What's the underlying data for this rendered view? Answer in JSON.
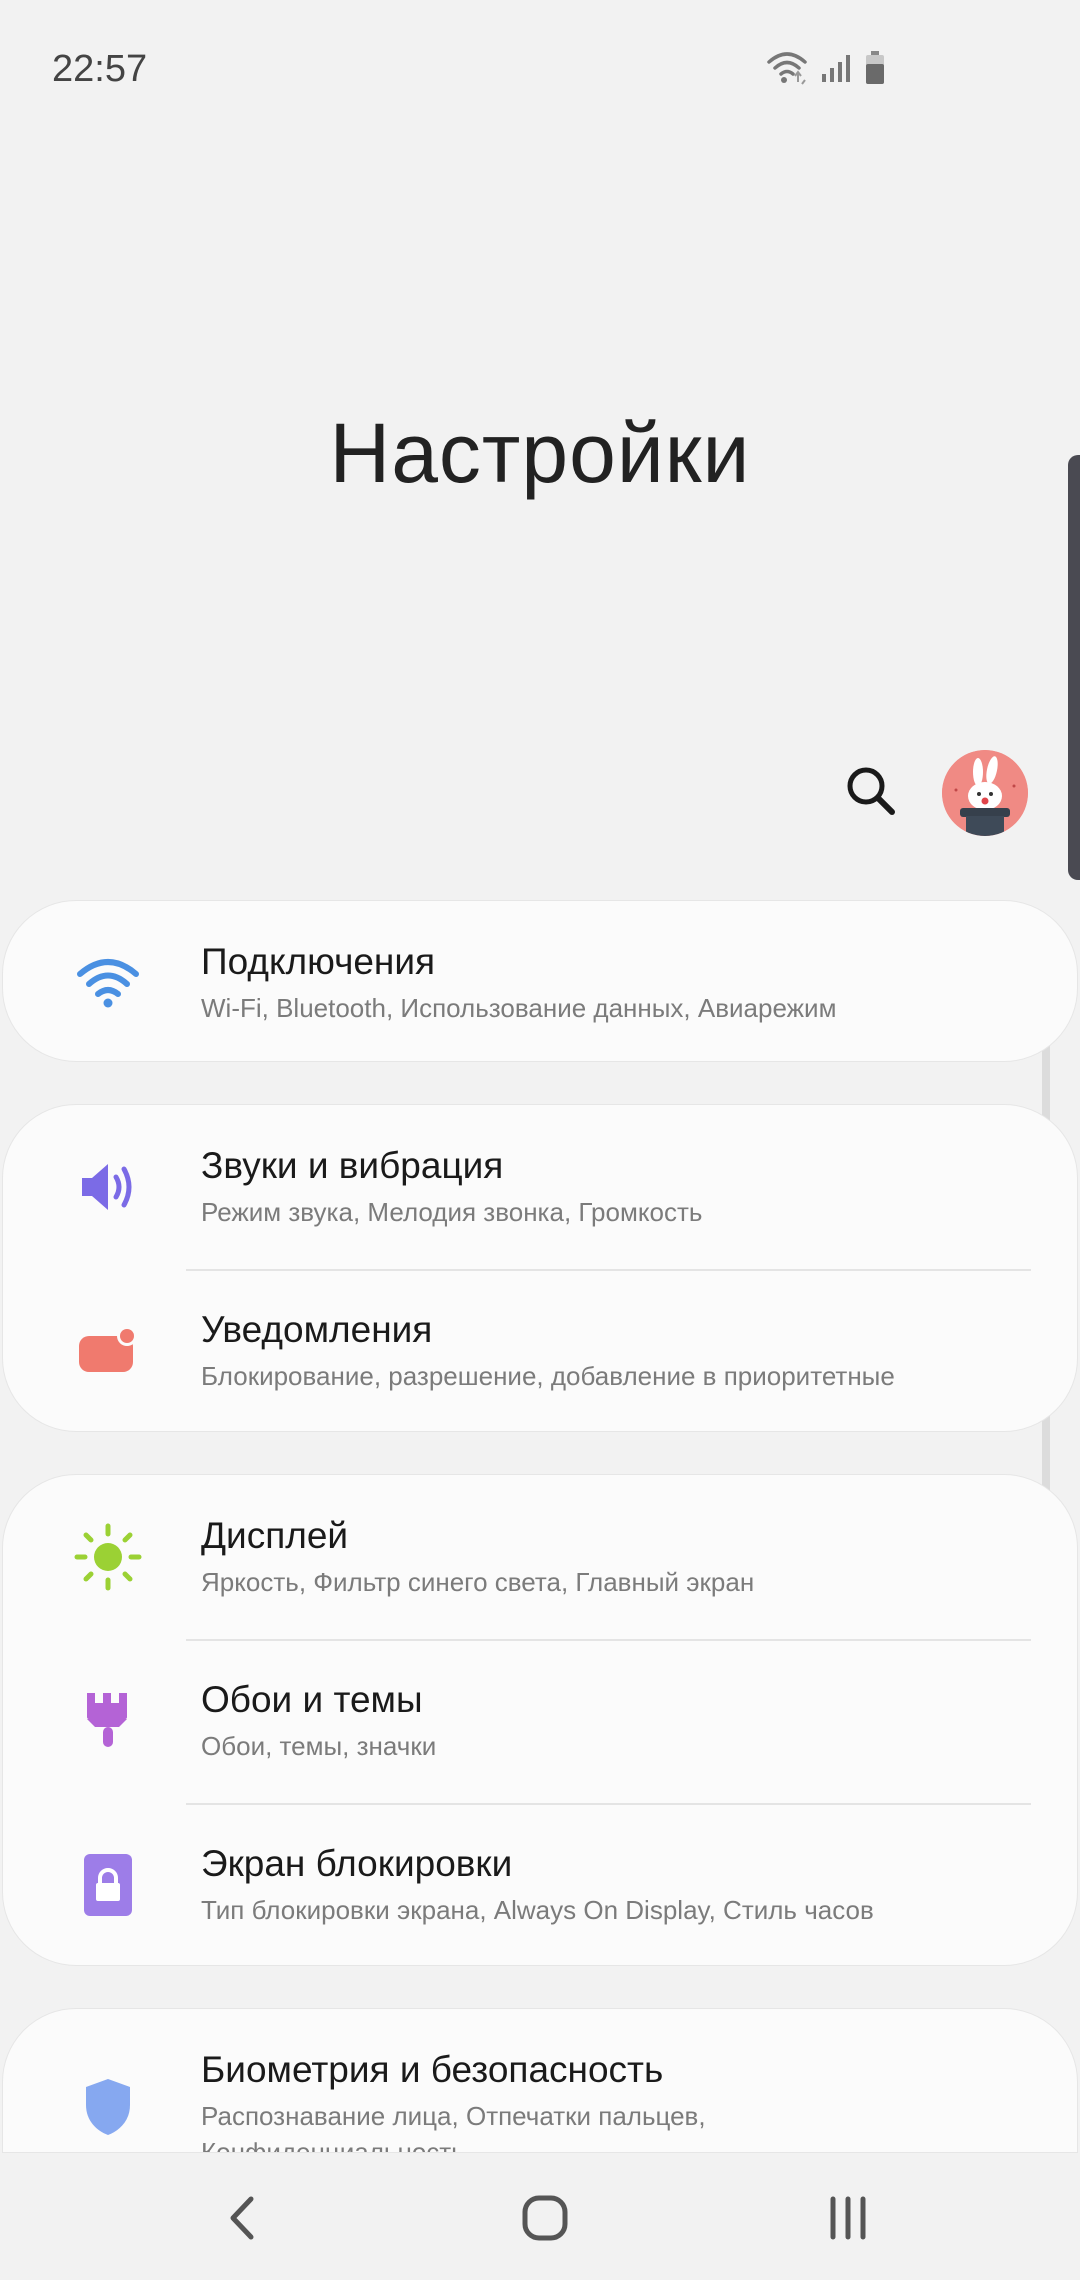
{
  "status_bar": {
    "time": "22:57",
    "icons": [
      "wifi-icon",
      "signal-icon",
      "battery-icon"
    ]
  },
  "header": {
    "title": "Настройки",
    "search_icon": "search-icon",
    "avatar": "profile-avatar"
  },
  "groups": [
    {
      "items": [
        {
          "title": "Подключения",
          "subtitle": "Wi-Fi, Bluetooth, Использование данных, Авиарежим",
          "icon": "wifi-icon",
          "color": "#4a90e2"
        }
      ]
    },
    {
      "items": [
        {
          "title": "Звуки и вибрация",
          "subtitle": "Режим звука, Мелодия звонка, Громкость",
          "icon": "volume-icon",
          "color": "#7b6be6"
        },
        {
          "title": "Уведомления",
          "subtitle": "Блокирование, разрешение, добавление в приоритетные",
          "icon": "notification-icon",
          "color": "#f07a6e"
        }
      ]
    },
    {
      "items": [
        {
          "title": "Дисплей",
          "subtitle": "Яркость, Фильтр синего света, Главный экран",
          "icon": "sun-icon",
          "color": "#9bd134"
        },
        {
          "title": "Обои и темы",
          "subtitle": "Обои, темы, значки",
          "icon": "brush-icon",
          "color": "#b463d6"
        },
        {
          "title": "Экран блокировки",
          "subtitle": "Тип блокировки экрана, Always On Display, Стиль часов",
          "icon": "lock-icon",
          "color": "#9d7de8"
        }
      ]
    },
    {
      "items": [
        {
          "title": "Биометрия и безопасность",
          "subtitle": "Распознавание лица, Отпечатки пальцев,",
          "subtitle2": "Конфиденциальность",
          "icon": "shield-icon",
          "color": "#86a8f0"
        }
      ]
    }
  ],
  "nav_bar": {
    "back": "back-icon",
    "home": "home-icon",
    "recents": "recents-icon"
  }
}
